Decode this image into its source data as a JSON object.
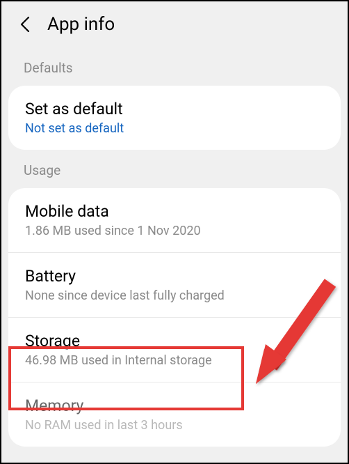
{
  "header": {
    "title": "App info"
  },
  "sections": {
    "defaults": {
      "label": "Defaults",
      "setAsDefault": {
        "title": "Set as default",
        "subtitle": "Not set as default"
      }
    },
    "usage": {
      "label": "Usage",
      "mobileData": {
        "title": "Mobile data",
        "subtitle": "1.86 MB used since 1 Nov 2020"
      },
      "battery": {
        "title": "Battery",
        "subtitle": "None since device last fully charged"
      },
      "storage": {
        "title": "Storage",
        "subtitle": "46.98 MB used in Internal storage"
      },
      "memory": {
        "title": "Memory",
        "subtitle": "No RAM used in last 3 hours"
      }
    }
  }
}
